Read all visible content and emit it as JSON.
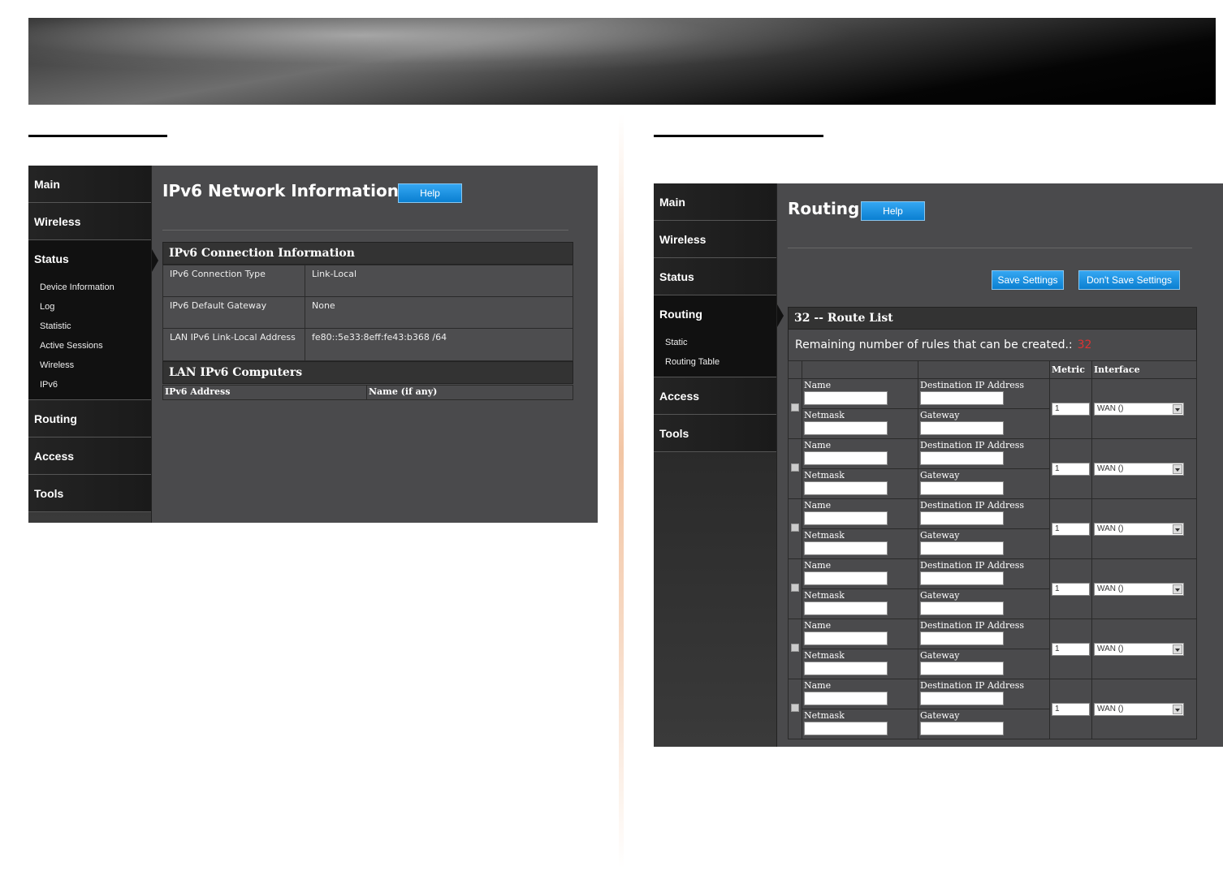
{
  "left_panel": {
    "nav": {
      "items": [
        "Main",
        "Wireless",
        "Status",
        "Routing",
        "Access",
        "Tools"
      ],
      "status_sub": [
        "Device Information",
        "Log",
        "Statistic",
        "Active Sessions",
        "Wireless",
        "IPv6"
      ]
    },
    "title": "IPv6 Network Information",
    "help_label": "Help",
    "conn_section": "IPv6 Connection Information",
    "rows": [
      {
        "label": "IPv6 Connection Type",
        "value": "Link-Local"
      },
      {
        "label": "IPv6 Default Gateway",
        "value": "None"
      },
      {
        "label": "LAN IPv6 Link-Local Address",
        "value": "fe80::5e33:8eff:fe43:b368 /64"
      }
    ],
    "computers_section": "LAN IPv6 Computers",
    "computers_cols": [
      "IPv6 Address",
      "Name (if any)"
    ]
  },
  "right_panel": {
    "nav": {
      "items": [
        "Main",
        "Wireless",
        "Status",
        "Routing",
        "Access",
        "Tools"
      ],
      "routing_sub": [
        "Static",
        "Routing Table"
      ]
    },
    "title": "Routing",
    "help_label": "Help",
    "save_label": "Save Settings",
    "dont_save_label": "Don't Save Settings",
    "list_title": "32 -- Route List",
    "remaining_label": "Remaining number of rules that can be created.:",
    "remaining_count": "32",
    "columns": {
      "metric": "Metric",
      "interface": "Interface"
    },
    "field_labels": {
      "name": "Name",
      "dest": "Destination IP Address",
      "netmask": "Netmask",
      "gateway": "Gateway"
    },
    "rows": [
      {
        "metric": "1",
        "interface": "WAN ()"
      },
      {
        "metric": "1",
        "interface": "WAN ()"
      },
      {
        "metric": "1",
        "interface": "WAN ()"
      },
      {
        "metric": "1",
        "interface": "WAN ()"
      },
      {
        "metric": "1",
        "interface": "WAN ()"
      },
      {
        "metric": "1",
        "interface": "WAN ()"
      }
    ]
  }
}
